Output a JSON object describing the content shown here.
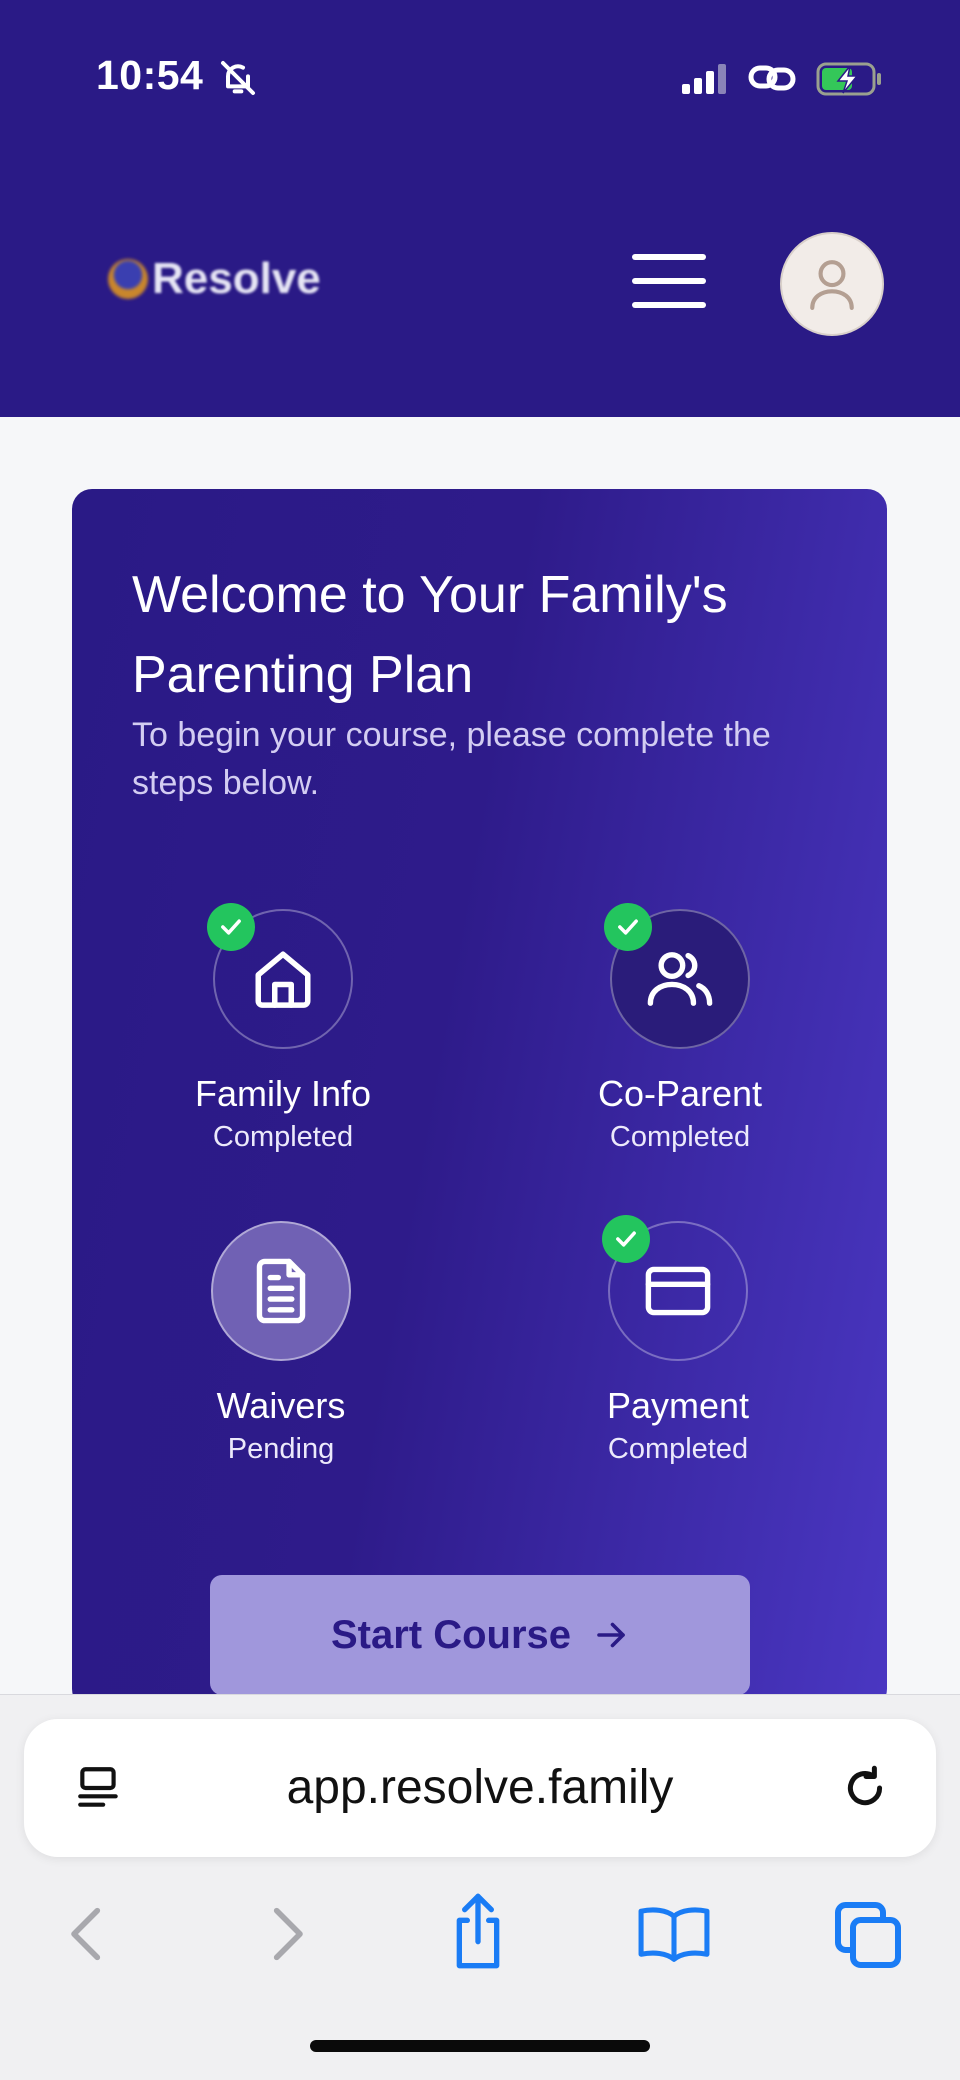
{
  "status_bar": {
    "time": "10:54"
  },
  "header": {
    "logo_text": "Resolve",
    "menu_icon": "hamburger-menu-icon",
    "avatar_icon": "user-icon"
  },
  "card": {
    "title": "Welcome to Your Family's Parenting Plan",
    "subtitle": "To begin your course, please complete the steps below.",
    "steps": [
      {
        "label": "Family Info",
        "status": "Completed",
        "icon": "home-icon",
        "done": true
      },
      {
        "label": "Co-Parent",
        "status": "Completed",
        "icon": "users-icon",
        "done": true
      },
      {
        "label": "Waivers",
        "status": "Pending",
        "icon": "document-icon",
        "done": false
      },
      {
        "label": "Payment",
        "status": "Completed",
        "icon": "credit-card-icon",
        "done": true
      }
    ],
    "start_button": "Start Course"
  },
  "browser": {
    "url": "app.resolve.family",
    "controls": [
      "back-icon",
      "forward-icon",
      "share-icon",
      "bookmarks-icon",
      "tabs-icon"
    ]
  },
  "colors": {
    "header_bg": "#2a1a86",
    "card_gradient_start": "#2a1a86",
    "card_gradient_end": "#4a37c2",
    "check_green": "#23c55e",
    "button_bg": "#a097dc",
    "browser_blue": "#1a7cf5"
  }
}
